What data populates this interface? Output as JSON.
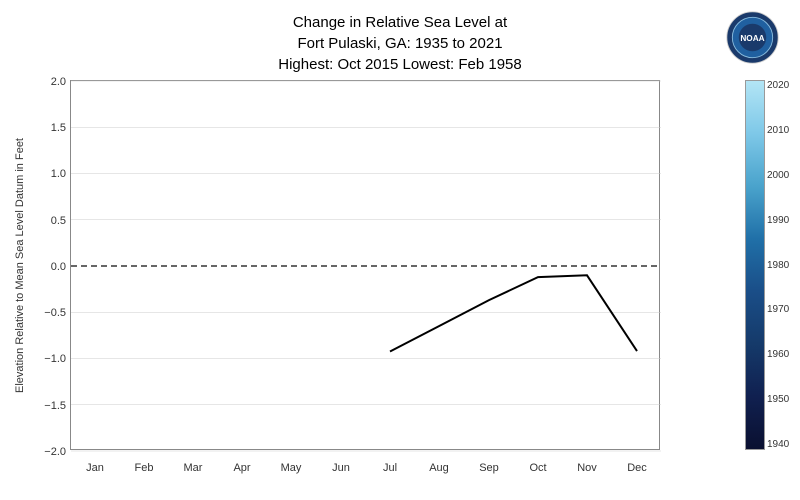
{
  "title": {
    "line1": "Change in Relative Sea Level at",
    "line2": "Fort Pulaski, GA: 1935 to 2021",
    "line3": "Highest: Oct 2015     Lowest: Feb 1958"
  },
  "yaxis": {
    "label": "Elevation Relative to Mean Sea Level Datum in Feet",
    "ticks": [
      "2.0",
      "1.5",
      "1.0",
      "0.5",
      "0.0",
      "-0.5",
      "-1.0",
      "-1.5",
      "-2.0"
    ]
  },
  "xaxis": {
    "labels": [
      "Jan",
      "Feb",
      "Mar",
      "Apr",
      "May",
      "Jun",
      "Jul",
      "Aug",
      "Sep",
      "Oct",
      "Nov",
      "Dec"
    ]
  },
  "colorbar": {
    "labels": [
      "2020",
      "2010",
      "2000",
      "1990",
      "1980",
      "1970",
      "1960",
      "1950",
      "1940"
    ]
  },
  "chart": {
    "zero_line_y": 0.0,
    "data_points": [
      {
        "month": "Jul",
        "value": -0.93
      },
      {
        "month": "Aug",
        "value": -0.65
      },
      {
        "month": "Sep",
        "value": -0.37
      },
      {
        "month": "Oct",
        "value": -0.12
      },
      {
        "month": "Nov",
        "value": -0.1
      },
      {
        "month": "Dec",
        "value": -0.92
      }
    ]
  },
  "noaa": {
    "label": "NOAA Logo"
  }
}
